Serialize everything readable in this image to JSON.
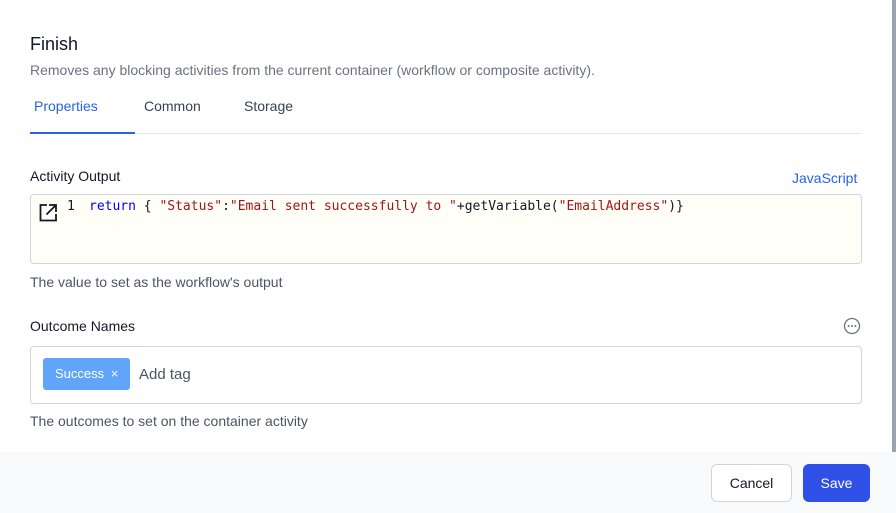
{
  "dialog": {
    "title": "Finish",
    "subtitle": "Removes any blocking activities from the current container (workflow or composite activity)."
  },
  "tabs": [
    {
      "label": "Properties",
      "active": true
    },
    {
      "label": "Common",
      "active": false
    },
    {
      "label": "Storage",
      "active": false
    }
  ],
  "activity_output": {
    "label": "Activity Output",
    "syntax": "JavaScript",
    "line_number": "1",
    "code": {
      "keyword": "return",
      "open": " { ",
      "key": "\"Status\"",
      "colon": ":",
      "string": "\"Email sent successfully to \"",
      "concat": "+getVariable(",
      "arg": "\"EmailAddress\"",
      "close": ")}"
    },
    "help": "The value to set as the workflow's output",
    "expand_icon": "expand-icon"
  },
  "outcome_names": {
    "label": "Outcome Names",
    "tags": [
      {
        "label": "Success",
        "remove": "×"
      }
    ],
    "placeholder": "Add tag",
    "help": "The outcomes to set on the container activity",
    "more_icon": "more-options-icon"
  },
  "footer": {
    "cancel_label": "Cancel",
    "save_label": "Save"
  },
  "colors": {
    "accent": "#2563eb",
    "save_button": "#2f50e6",
    "tag": "#60a5fa",
    "editor_bg": "#fffff8"
  }
}
